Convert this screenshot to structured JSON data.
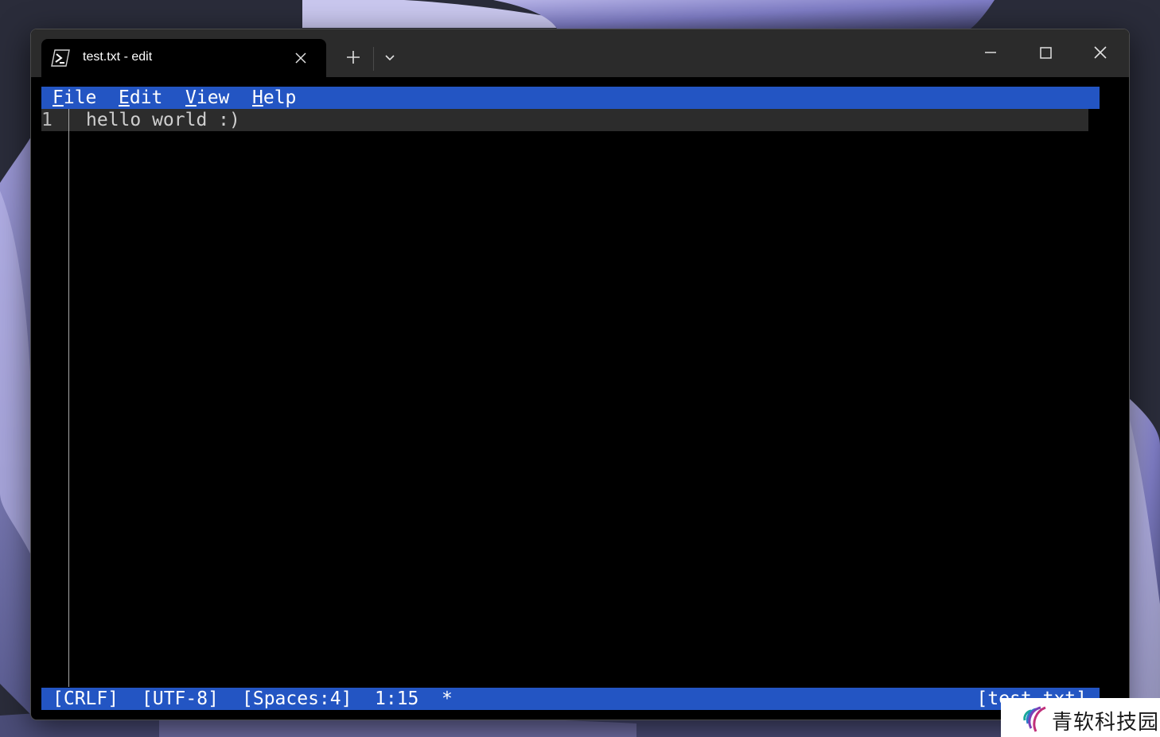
{
  "tab": {
    "title": "test.txt - edit",
    "icon": "powershell-icon"
  },
  "window_controls": {
    "new_tab_icon": "plus-icon",
    "dropdown_icon": "chevron-down-icon",
    "minimize_icon": "minimize-icon",
    "maximize_icon": "maximize-icon",
    "close_icon": "close-icon"
  },
  "menu": [
    {
      "accel": "F",
      "rest": "ile"
    },
    {
      "accel": "E",
      "rest": "dit"
    },
    {
      "accel": "V",
      "rest": "iew"
    },
    {
      "accel": "H",
      "rest": "elp"
    }
  ],
  "editor": {
    "line_number": "1",
    "line_text": "hello world :)"
  },
  "status": {
    "line_ending": "[CRLF]",
    "encoding": "[UTF-8]",
    "indent": "[Spaces:4]",
    "cursor_position": "1:15",
    "modified_marker": "*",
    "filename": "[test.txt]"
  },
  "watermark": {
    "text": "青软科技园"
  },
  "colors": {
    "menu_bar": "#2355c3",
    "status_bar": "#2355c3",
    "editor_bg": "#000000",
    "titlebar": "#2b2b2b"
  }
}
